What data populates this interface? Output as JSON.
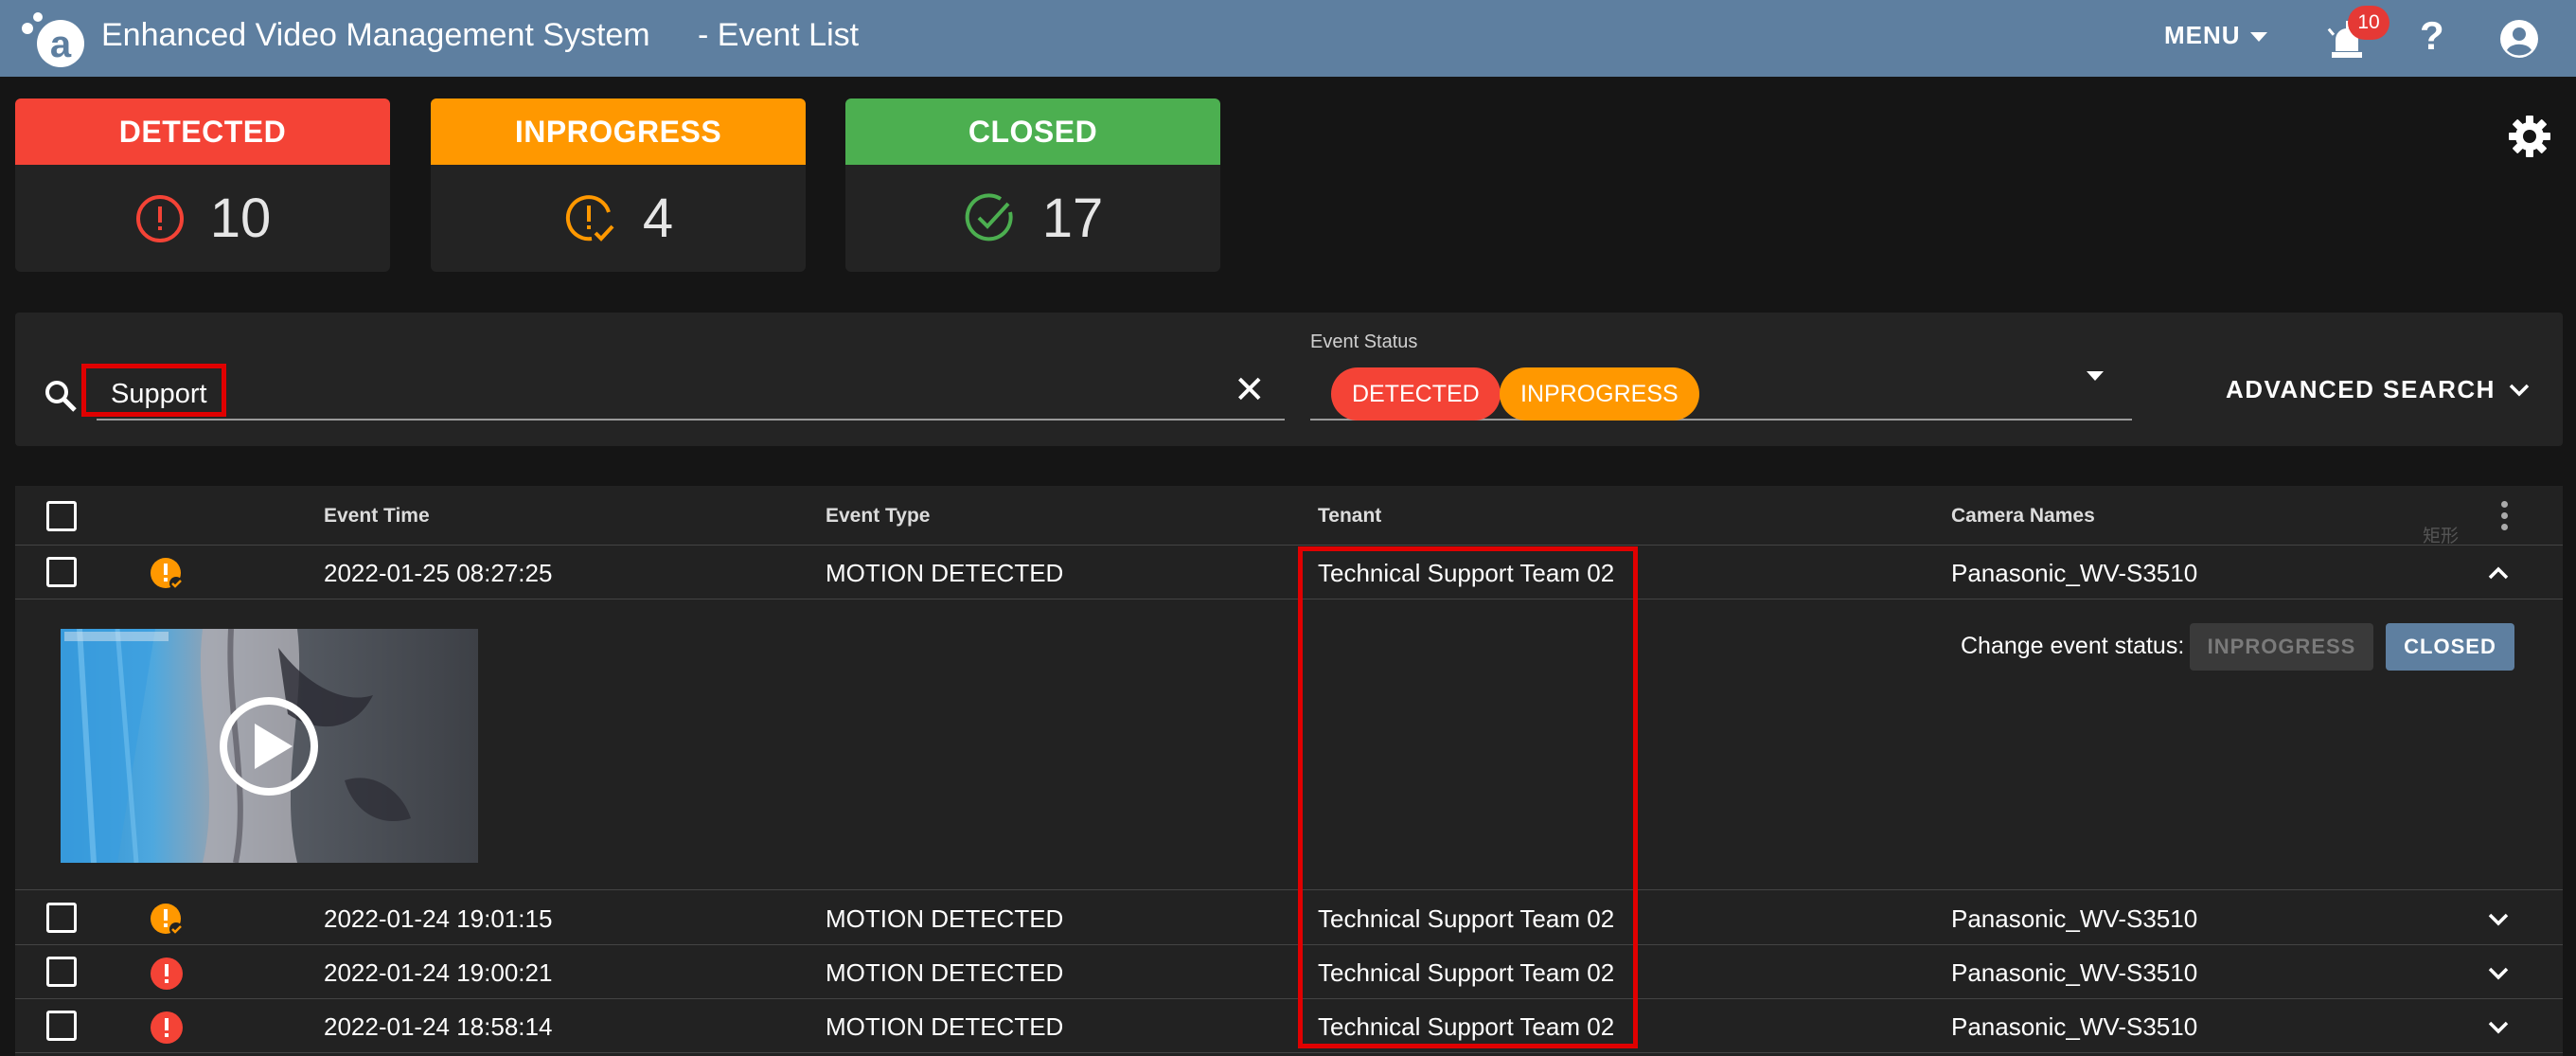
{
  "header": {
    "app_title": "Enhanced Video Management System",
    "page_title": "- Event List",
    "menu_label": "MENU",
    "alarm_count": "10",
    "help_label": "?",
    "bar_color": "#5e7fa0"
  },
  "cards": [
    {
      "label": "DETECTED",
      "count": "10",
      "color": "#f44336",
      "icon": "error-outline-icon"
    },
    {
      "label": "INPROGRESS",
      "count": "4",
      "color": "#ff9800",
      "icon": "pending-check-icon"
    },
    {
      "label": "CLOSED",
      "count": "17",
      "color": "#4caf50",
      "icon": "check-circle-icon"
    }
  ],
  "search": {
    "value": "Support",
    "placeholder": ""
  },
  "status_filter": {
    "label": "Event Status",
    "chips": [
      "DETECTED",
      "INPROGRESS"
    ]
  },
  "advanced_search_label": "ADVANCED SEARCH",
  "table": {
    "columns": [
      "Event Time",
      "Event Type",
      "Tenant",
      "Camera Names"
    ],
    "ghost_text": "矩形",
    "rows": [
      {
        "status": "inprogress",
        "time": "2022-01-25 08:27:25",
        "type": "MOTION DETECTED",
        "tenant": "Technical Support Team 02",
        "camera": "Panasonic_WV-S3510",
        "expanded": true
      },
      {
        "status": "inprogress",
        "time": "2022-01-24 19:01:15",
        "type": "MOTION DETECTED",
        "tenant": "Technical Support Team 02",
        "camera": "Panasonic_WV-S3510",
        "expanded": false
      },
      {
        "status": "detected",
        "time": "2022-01-24 19:00:21",
        "type": "MOTION DETECTED",
        "tenant": "Technical Support Team 02",
        "camera": "Panasonic_WV-S3510",
        "expanded": false
      },
      {
        "status": "detected",
        "time": "2022-01-24 18:58:14",
        "type": "MOTION DETECTED",
        "tenant": "Technical Support Team 02",
        "camera": "Panasonic_WV-S3510",
        "expanded": false
      }
    ]
  },
  "expanded_panel": {
    "change_status_label": "Change event status:",
    "inprogress_button": "INPROGRESS",
    "closed_button": "CLOSED"
  }
}
